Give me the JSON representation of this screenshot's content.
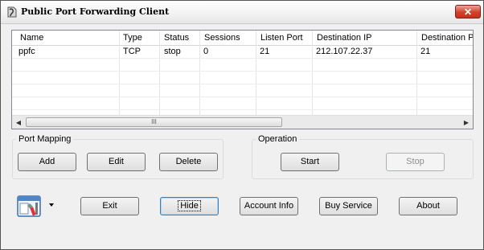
{
  "window": {
    "title": "Public Port Forwarding Client",
    "close_symbol": "✕"
  },
  "listview": {
    "columns": [
      "Name",
      "Type",
      "Status",
      "Sessions",
      "Listen Port",
      "Destination IP",
      "Destination P"
    ],
    "rows": [
      [
        "ppfc",
        "TCP",
        "stop",
        "0",
        "21",
        "212.107.22.37",
        "21"
      ]
    ],
    "scroll_grip": "III",
    "scroll_left_arrow": "◀",
    "scroll_right_arrow": "▶"
  },
  "port_mapping": {
    "label": "Port Mapping",
    "add_label": "Add",
    "edit_label": "Edit",
    "delete_label": "Delete"
  },
  "operation": {
    "label": "Operation",
    "start_label": "Start",
    "stop_label": "Stop"
  },
  "bottom": {
    "exit_label": "Exit",
    "hide_label": "Hide",
    "account_info_label": "Account Info",
    "buy_service_label": "Buy Service",
    "about_label": "About"
  },
  "icons": {
    "app": "app-icon",
    "tools": "tools-icon"
  }
}
